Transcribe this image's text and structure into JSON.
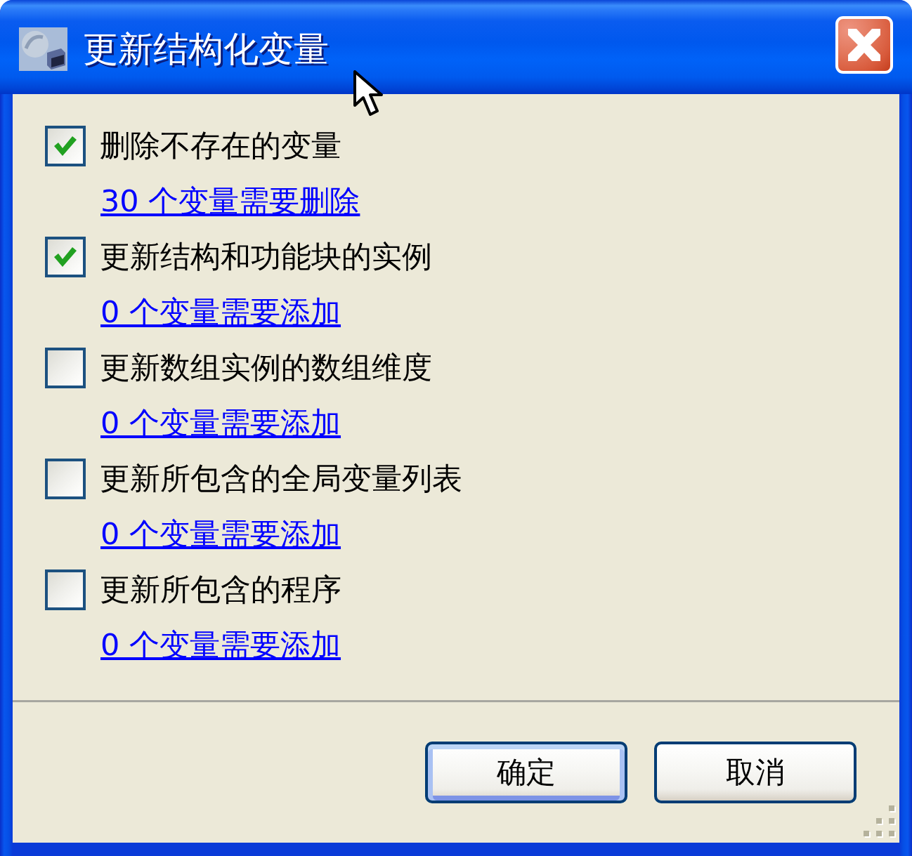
{
  "window": {
    "title": "更新结构化变量"
  },
  "options": [
    {
      "label": "删除不存在的变量",
      "checked": true,
      "link": "30 个变量需要删除"
    },
    {
      "label": "更新结构和功能块的实例",
      "checked": true,
      "link": "0 个变量需要添加"
    },
    {
      "label": "更新数组实例的数组维度",
      "checked": false,
      "link": "0 个变量需要添加"
    },
    {
      "label": "更新所包含的全局变量列表",
      "checked": false,
      "link": "0 个变量需要添加"
    },
    {
      "label": "更新所包含的程序",
      "checked": false,
      "link": "0 个变量需要添加"
    }
  ],
  "buttons": [
    {
      "label": "确定",
      "default": true
    },
    {
      "label": "取消",
      "default": false
    }
  ]
}
